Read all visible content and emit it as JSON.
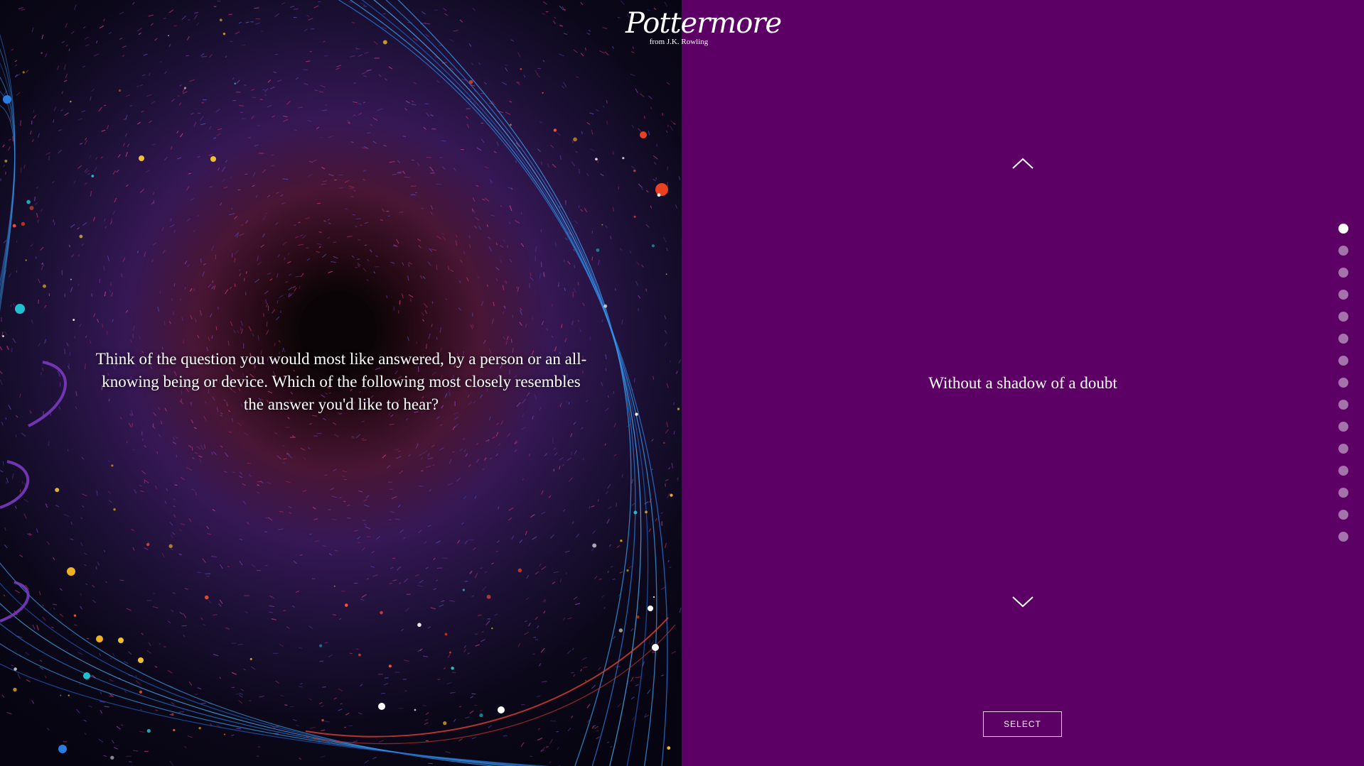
{
  "logo": {
    "wordmark": "Pottermore",
    "tagline": "from J.K. Rowling"
  },
  "question": {
    "text": "Think of the question you would most like answered, by a person or an all-knowing being or device. Which of the following most closely resembles the answer you'd like to hear?"
  },
  "answer": {
    "current": "Without a shadow of a doubt"
  },
  "controls": {
    "up_icon": "chevron-up-icon",
    "down_icon": "chevron-down-icon",
    "select_label": "SELECT"
  },
  "progress": {
    "total_steps": 15,
    "current_step": 1
  },
  "colors": {
    "right_panel_bg": "#5c0066",
    "text": "#ffffff"
  }
}
